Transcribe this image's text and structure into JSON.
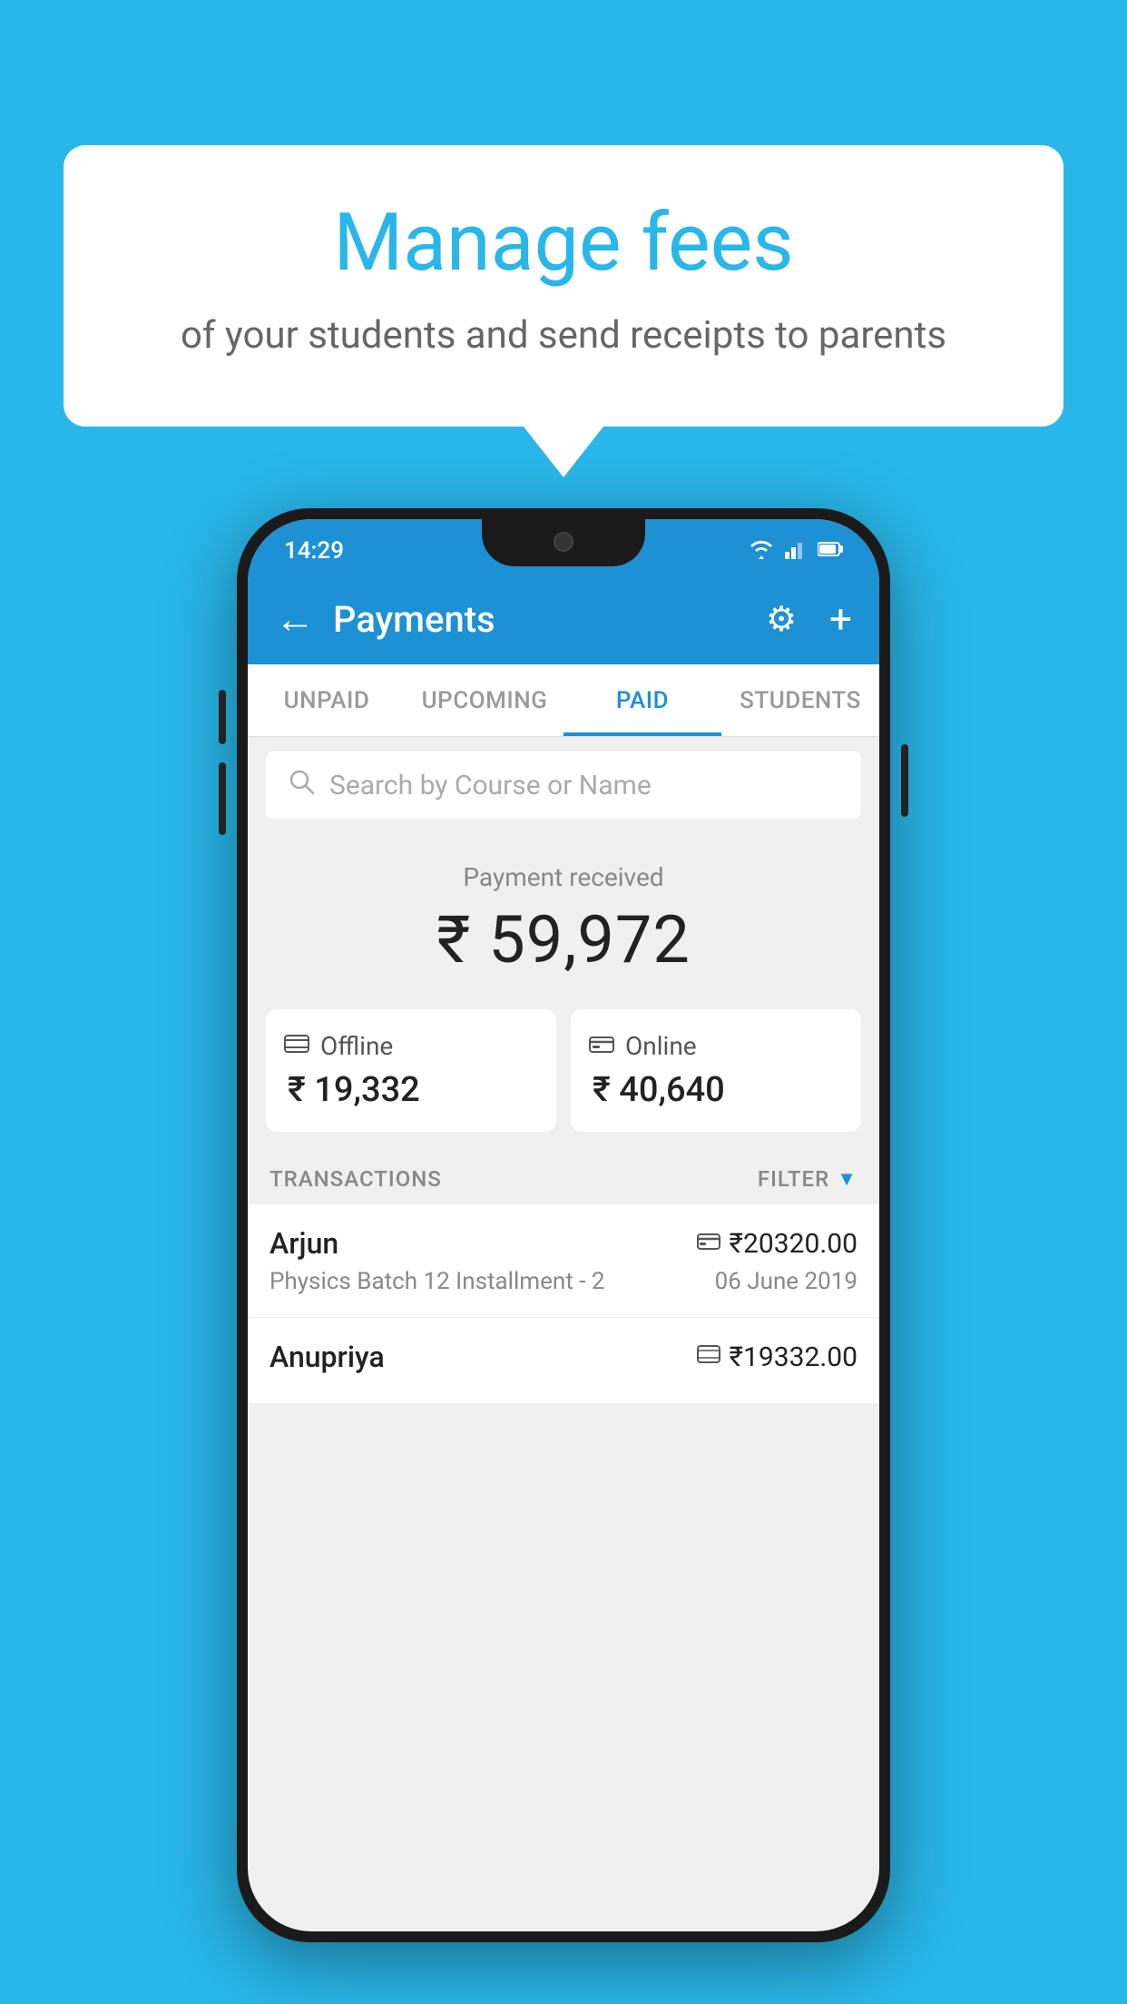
{
  "background_color": "#29b6e8",
  "speech_bubble": {
    "title": "Manage fees",
    "subtitle": "of your students and send receipts to parents"
  },
  "status_bar": {
    "time": "14:29",
    "wifi_icon": "▾",
    "signal_icon": "▲",
    "battery_icon": "▮"
  },
  "header": {
    "title": "Payments",
    "back_label": "←",
    "plus_label": "+",
    "gear_label": "⚙"
  },
  "tabs": [
    {
      "label": "UNPAID",
      "active": false
    },
    {
      "label": "UPCOMING",
      "active": false
    },
    {
      "label": "PAID",
      "active": true
    },
    {
      "label": "STUDENTS",
      "active": false
    }
  ],
  "search": {
    "placeholder": "Search by Course or Name"
  },
  "payment_received": {
    "label": "Payment received",
    "amount": "₹ 59,972"
  },
  "payment_cards": [
    {
      "type": "Offline",
      "amount": "₹ 19,332",
      "icon": "cash"
    },
    {
      "type": "Online",
      "amount": "₹ 40,640",
      "icon": "card"
    }
  ],
  "transactions_label": "TRANSACTIONS",
  "filter_label": "FILTER",
  "transactions": [
    {
      "name": "Arjun",
      "amount": "₹20320.00",
      "desc": "Physics Batch 12 Installment - 2",
      "date": "06 June 2019",
      "payment_type": "card"
    },
    {
      "name": "Anupriya",
      "amount": "₹19332.00",
      "desc": "",
      "date": "",
      "payment_type": "cash"
    }
  ]
}
